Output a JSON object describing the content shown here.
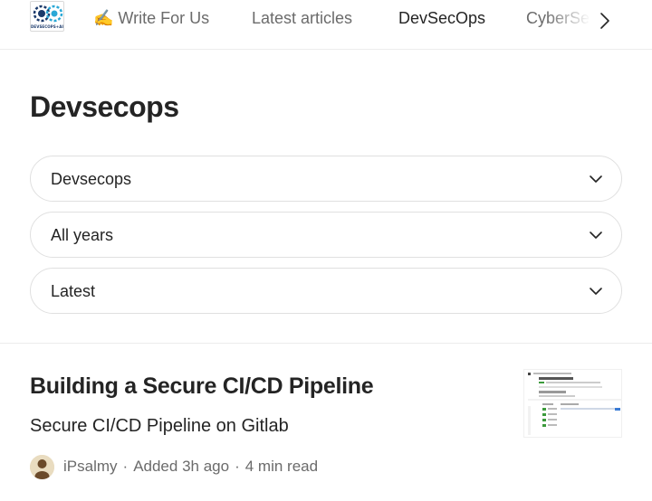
{
  "nav": {
    "logo_text": "DEVSECOPS+AI",
    "tabs": [
      {
        "label": "✍️ Write For Us",
        "active": false
      },
      {
        "label": "Latest articles",
        "active": false
      },
      {
        "label": "DevSecOps",
        "active": true
      },
      {
        "label": "CyberSec",
        "active": false
      }
    ],
    "next_icon": "chevron-right-icon"
  },
  "page": {
    "title": "Devsecops"
  },
  "filters": {
    "topic": "Devsecops",
    "year": "All years",
    "sort": "Latest",
    "chevron_icon": "chevron-down-icon"
  },
  "article": {
    "title": "Building a Secure CI/CD Pipeline",
    "subtitle": "Secure CI/CD Pipeline on Gitlab",
    "author": "iPsalmy",
    "separator": "·",
    "added": "Added 3h ago",
    "read_time": "4 min read"
  },
  "colors": {
    "text": "#242424",
    "muted": "#6b6b6b",
    "border": "#e0e0e0",
    "logo_blue": "#1b3a6b"
  }
}
